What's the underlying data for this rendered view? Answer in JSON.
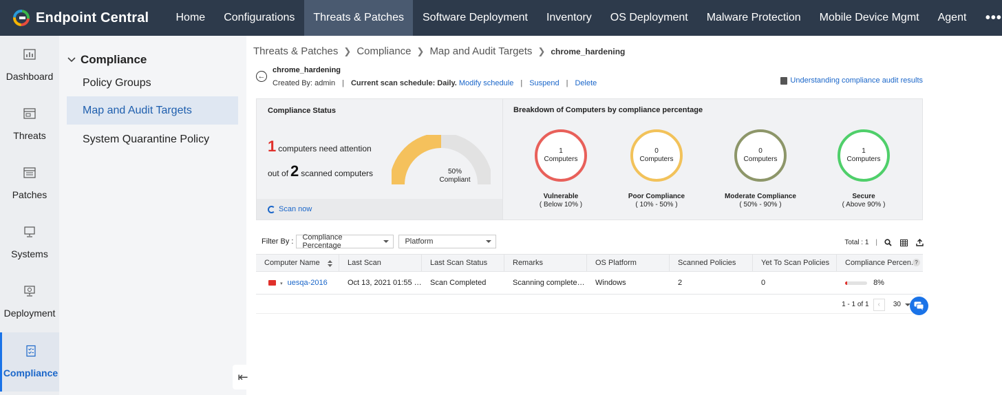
{
  "app": {
    "name": "Endpoint Central",
    "colors": {
      "topbar": "#2d3a4b",
      "accent": "#1a66c9",
      "danger": "#e0302b"
    }
  },
  "nav": {
    "items": [
      {
        "label": "Home"
      },
      {
        "label": "Configurations"
      },
      {
        "label": "Threats & Patches",
        "active": true
      },
      {
        "label": "Software Deployment"
      },
      {
        "label": "Inventory"
      },
      {
        "label": "OS Deployment"
      },
      {
        "label": "Malware Protection"
      },
      {
        "label": "Mobile Device Mgmt"
      },
      {
        "label": "Agent"
      }
    ],
    "more": "•••"
  },
  "rail": {
    "items": [
      {
        "label": "Dashboard",
        "icon": "dashboard-icon"
      },
      {
        "label": "Threats",
        "icon": "threats-icon"
      },
      {
        "label": "Patches",
        "icon": "patches-icon"
      },
      {
        "label": "Systems",
        "icon": "systems-icon"
      },
      {
        "label": "Deployment",
        "icon": "deployment-icon"
      },
      {
        "label": "Compliance",
        "icon": "compliance-icon",
        "active": true
      }
    ]
  },
  "subnav": {
    "header": "Compliance",
    "items": [
      {
        "label": "Policy Groups"
      },
      {
        "label": "Map and Audit Targets",
        "active": true
      },
      {
        "label": "System Quarantine Policy"
      }
    ],
    "collapse_glyph": "⇤"
  },
  "breadcrumb": {
    "items": [
      "Threats & Patches",
      "Compliance",
      "Map and Audit Targets"
    ],
    "current": "chrome_hardening"
  },
  "policy": {
    "title": "chrome_hardening",
    "created_by": "Created By: admin",
    "schedule_label": "Current scan schedule: Daily.",
    "modify_schedule": "Modify schedule",
    "suspend": "Suspend",
    "delete": "Delete",
    "help_link": "Understanding compliance audit results"
  },
  "status": {
    "title": "Compliance Status",
    "attention_count": "1",
    "attention_text": "computers need attention",
    "out_of": "out of",
    "scanned_count": "2",
    "scanned_text": "scanned computers",
    "gauge_percent": "50%",
    "gauge_label": "Compliant",
    "gauge_fraction": 0.5,
    "scan_now": "Scan now"
  },
  "breakdown": {
    "title": "Breakdown of Computers by compliance percentage",
    "unit": "Computers",
    "rings": [
      {
        "count": "1",
        "name": "Vulnerable",
        "range": "( Below 10% )",
        "color": "#e8605a"
      },
      {
        "count": "0",
        "name": "Poor Compliance",
        "range": "( 10% - 50% )",
        "color": "#f2c25a"
      },
      {
        "count": "0",
        "name": "Moderate Compliance",
        "range": "( 50% - 90% )",
        "color": "#8d9669"
      },
      {
        "count": "1",
        "name": "Secure",
        "range": "( Above 90% )",
        "color": "#4fcf6a"
      }
    ]
  },
  "filter": {
    "label": "Filter By :",
    "compliance_select": "Compliance Percentage",
    "platform_select": "Platform",
    "total": "Total : 1"
  },
  "table": {
    "columns": [
      "Computer Name",
      "Last Scan",
      "Last Scan Status",
      "Remarks",
      "OS Platform",
      "Scanned Policies",
      "Yet To Scan Policies",
      "Compliance Percen..."
    ],
    "help_glyph": "?",
    "rows": [
      {
        "computer": "uesqa-2016",
        "last_scan": "Oct 13, 2021 01:55 P...",
        "status": "Scan Completed",
        "remarks": "Scanning completed s...",
        "platform": "Windows",
        "scanned": "2",
        "yet_to_scan": "0",
        "compliance": "8%",
        "compliance_fraction": 0.08
      }
    ]
  },
  "pager": {
    "range": "1 - 1 of 1",
    "prev": "‹",
    "page_size": "30"
  }
}
